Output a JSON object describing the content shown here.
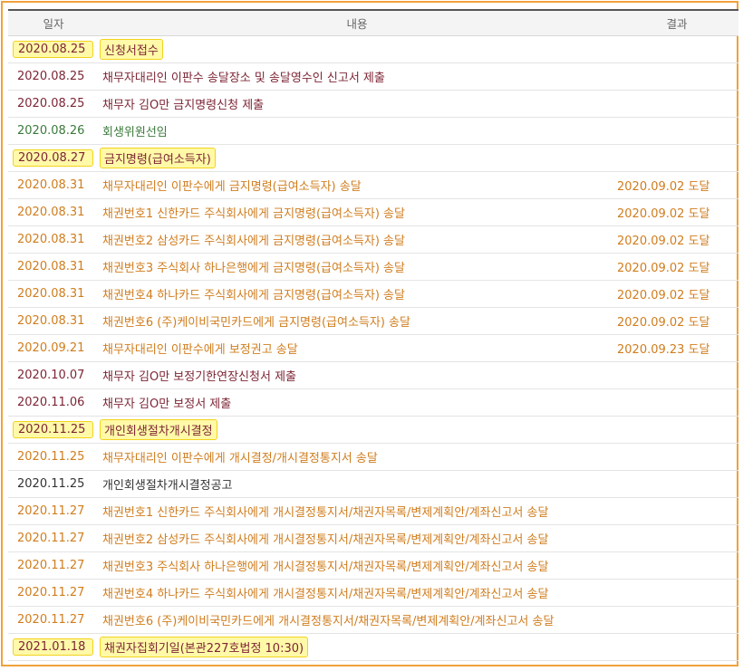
{
  "header": {
    "date": "일자",
    "content": "내용",
    "result": "결과"
  },
  "rows": [
    {
      "date": "2020.08.25",
      "content": "신청서접수",
      "result": ""
    },
    {
      "date": "2020.08.25",
      "content": "채무자대리인 이판수 송달장소 및 송달영수인 신고서 제출",
      "result": ""
    },
    {
      "date": "2020.08.25",
      "content": "채무자 김O만 금지명령신청 제출",
      "result": ""
    },
    {
      "date": "2020.08.26",
      "content": "회생위원선임",
      "result": ""
    },
    {
      "date": "2020.08.27",
      "content": "금지명령(급여소득자)",
      "result": ""
    },
    {
      "date": "2020.08.31",
      "content": "채무자대리인 이판수에게 금지명령(급여소득자) 송달",
      "result": "2020.09.02 도달"
    },
    {
      "date": "2020.08.31",
      "content": "채권번호1 신한카드 주식회사에게 금지명령(급여소득자) 송달",
      "result": "2020.09.02 도달"
    },
    {
      "date": "2020.08.31",
      "content": "채권번호2 삼성카드 주식회사에게 금지명령(급여소득자) 송달",
      "result": "2020.09.02 도달"
    },
    {
      "date": "2020.08.31",
      "content": "채권번호3 주식회사 하나은행에게 금지명령(급여소득자) 송달",
      "result": "2020.09.02 도달"
    },
    {
      "date": "2020.08.31",
      "content": "채권번호4 하나카드 주식회사에게 금지명령(급여소득자) 송달",
      "result": "2020.09.02 도달"
    },
    {
      "date": "2020.08.31",
      "content": "채권번호6 (주)케이비국민카드에게 금지명령(급여소득자) 송달",
      "result": "2020.09.02 도달"
    },
    {
      "date": "2020.09.21",
      "content": "채무자대리인 이판수에게 보정권고 송달",
      "result": "2020.09.23 도달"
    },
    {
      "date": "2020.10.07",
      "content": "채무자 김O만 보정기한연장신청서 제출",
      "result": ""
    },
    {
      "date": "2020.11.06",
      "content": "채무자 김O만 보정서 제출",
      "result": ""
    },
    {
      "date": "2020.11.25",
      "content": "개인회생절차개시결정",
      "result": ""
    },
    {
      "date": "2020.11.25",
      "content": "채무자대리인 이판수에게 개시결정/개시결정통지서 송달",
      "result": ""
    },
    {
      "date": "2020.11.25",
      "content": "개인회생절차개시결정공고",
      "result": ""
    },
    {
      "date": "2020.11.27",
      "content": "채권번호1 신한카드 주식회사에게 개시결정통지서/채권자목록/변제계획안/계좌신고서 송달",
      "result": ""
    },
    {
      "date": "2020.11.27",
      "content": "채권번호2 삼성카드 주식회사에게 개시결정통지서/채권자목록/변제계획안/계좌신고서 송달",
      "result": ""
    },
    {
      "date": "2020.11.27",
      "content": "채권번호3 주식회사 하나은행에게 개시결정통지서/채권자목록/변제계획안/계좌신고서 송달",
      "result": ""
    },
    {
      "date": "2020.11.27",
      "content": "채권번호4 하나카드 주식회사에게 개시결정통지서/채권자목록/변제계획안/계좌신고서 송달",
      "result": ""
    },
    {
      "date": "2020.11.27",
      "content": "채권번호6 (주)케이비국민카드에게 개시결정통지서/채권자목록/변제계획안/계좌신고서 송달",
      "result": ""
    },
    {
      "date": "2021.01.18",
      "content": "채권자집회기일(본관227호법정 10:30)",
      "result": ""
    }
  ],
  "colors": {
    "frame_border": "#f0a23c",
    "highlight_fill": "#fff9a8",
    "highlight_border": "#f2d31c",
    "text_red": "#7d2535",
    "text_green": "#3b7a3b",
    "text_orange": "#d07d1e",
    "text_dark": "#333333"
  }
}
